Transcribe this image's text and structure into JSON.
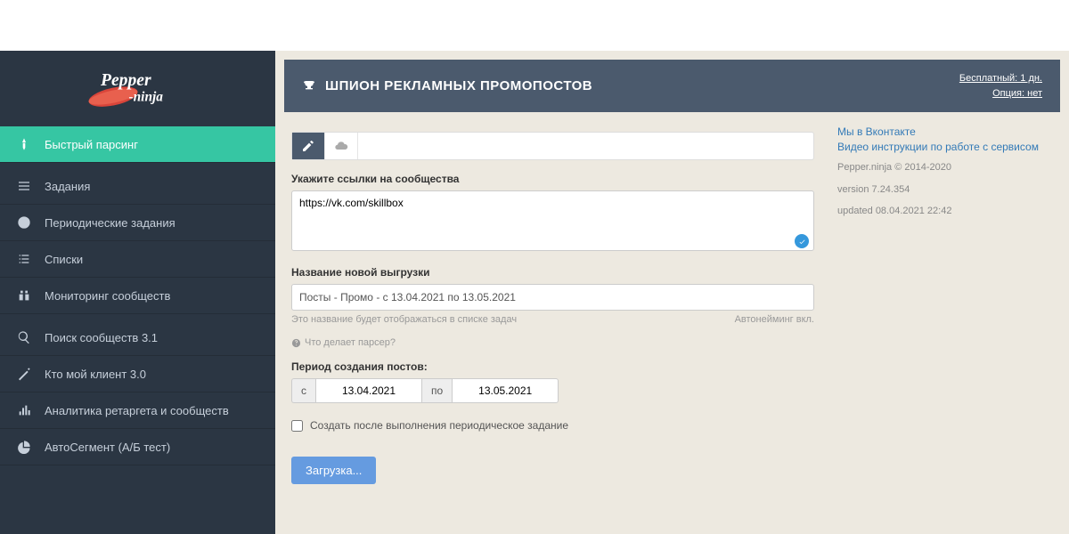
{
  "logo": {
    "text1": "Pepper",
    "text2": "-ninja"
  },
  "sidebar": {
    "primary": {
      "label": "Быстрый парсинг"
    },
    "group1": [
      {
        "label": "Задания"
      },
      {
        "label": "Периодические задания"
      },
      {
        "label": "Списки"
      },
      {
        "label": "Мониторинг сообществ"
      }
    ],
    "group2": [
      {
        "label": "Поиск сообществ 3.1"
      },
      {
        "label": "Кто мой клиент 3.0"
      },
      {
        "label": "Аналитика ретаргета и сообществ"
      },
      {
        "label": "АвтоСегмент (А/Б тест)"
      }
    ]
  },
  "header": {
    "title": "ШПИОН РЕКЛАМНЫХ ПРОМОПОСТОВ",
    "right": {
      "line1": "Бесплатный: 1 дн.",
      "line2": "Опция: нет"
    }
  },
  "form": {
    "links_label": "Укажите ссылки на сообщества",
    "links_value": "https://vk.com/skillbox",
    "name_label": "Название новой выгрузки",
    "name_value": "Посты - Промо - с 13.04.2021 по 13.05.2021",
    "hint_left": "Это название будет отображаться в списке задач",
    "hint_right": "Автонейминг вкл.",
    "help_text": "Что делает парсер?",
    "period_label": "Период создания постов:",
    "date_from_prefix": "с",
    "date_from": "13.04.2021",
    "date_to_prefix": "по",
    "date_to": "13.05.2021",
    "checkbox_label": "Создать после выполнения периодическое задание",
    "submit_label": "Загрузка..."
  },
  "side": {
    "link1": "Мы в Вконтакте",
    "link2": "Видео инструкции по работе с сервисом",
    "copyright": "Pepper.ninja © 2014-2020",
    "version": "version 7.24.354",
    "updated": "updated 08.04.2021 22:42"
  }
}
